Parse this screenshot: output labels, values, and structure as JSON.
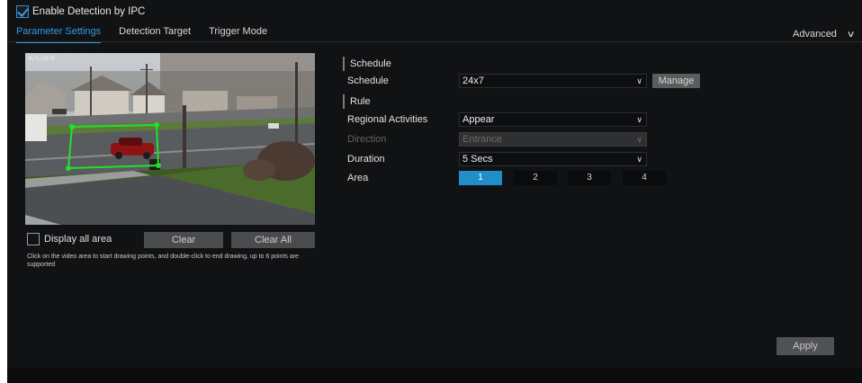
{
  "header": {
    "enable_label": "Enable Detection by IPC",
    "enable_checked": true
  },
  "tabs": [
    {
      "label": "Parameter Settings",
      "active": true
    },
    {
      "label": "Detection Target",
      "active": false
    },
    {
      "label": "Trigger Mode",
      "active": false
    }
  ],
  "advanced": {
    "label": "Advanced",
    "icon": "chevron-down-icon"
  },
  "video": {
    "osd_text": "0/1/1970"
  },
  "draw_controls": {
    "display_all_label": "Display all area",
    "display_all_checked": false,
    "clear_label": "Clear",
    "clear_all_label": "Clear All",
    "hint": "Click on the video area to start drawing points, and double-click to end drawing, up to 6 points are supported"
  },
  "schedule_section": {
    "title": "Schedule",
    "schedule_label": "Schedule",
    "schedule_value": "24x7",
    "manage_label": "Manage"
  },
  "rule_section": {
    "title": "Rule",
    "regional_label": "Regional Activities",
    "regional_value": "Appear",
    "direction_label": "Direction",
    "direction_value": "Entrance",
    "duration_label": "Duration",
    "duration_value": "5 Secs",
    "area_label": "Area",
    "areas": [
      "1",
      "2",
      "3",
      "4"
    ],
    "active_area": "1"
  },
  "apply_label": "Apply",
  "colors": {
    "background": "#111214",
    "accent": "#2f9ae6",
    "area_active": "#1f8ec9",
    "detection_region": "#22e02a"
  }
}
